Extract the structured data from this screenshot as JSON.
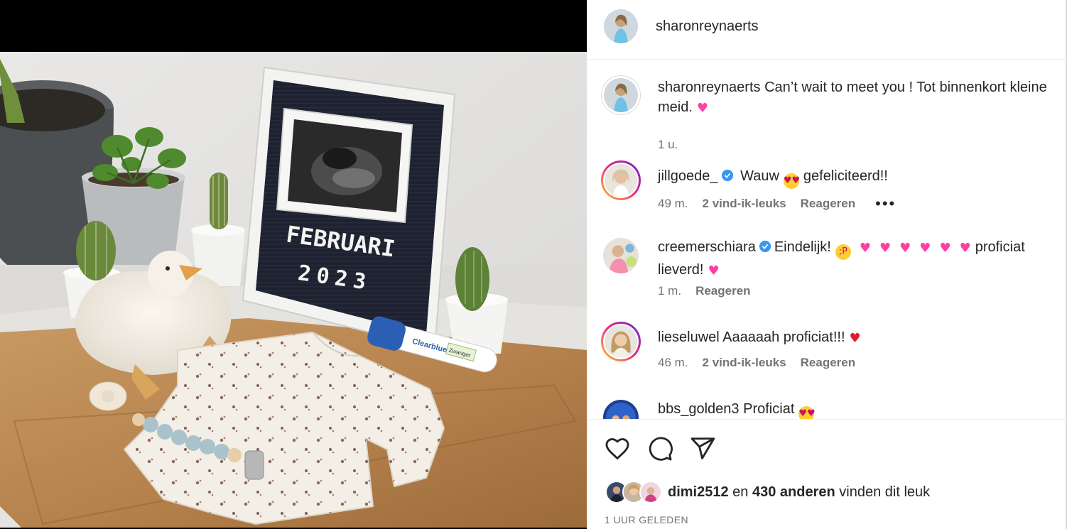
{
  "post": {
    "author": "sharonreynaerts",
    "caption": "Can’t wait to meet you ! Tot binnenkort kleine",
    "caption_line2": "meid.",
    "caption_emoji": "heart-emoji",
    "time_ago": "1 u."
  },
  "photo": {
    "letterboard_line1": "FEBRUARI",
    "letterboard_line2": "2023",
    "test_brand": "Clearblue",
    "test_result": "Zwanger"
  },
  "comments": [
    {
      "username": "jillgoede_",
      "verified": true,
      "text": "Wauw",
      "text_after": "gefeliciteerd!!",
      "time": "49 m.",
      "likes": "2 vind-ik-leuks",
      "reply": "Reageren",
      "more": "•••"
    },
    {
      "username": "creemerschiara",
      "verified": true,
      "text": "Eindelijk!",
      "text_after": "proficiat",
      "text_line2": "lieverd!",
      "time": "1 m.",
      "reply": "Reageren"
    },
    {
      "username": "lieseluwel",
      "verified": false,
      "text": "Aaaaaah proficiat!!!",
      "time": "46 m.",
      "likes": "2 vind-ik-leuks",
      "reply": "Reageren"
    },
    {
      "username": "bbs_golden3",
      "verified": false,
      "text": "Proficiat"
    }
  ],
  "likes": {
    "first_user": "dimi2512",
    "connector": "en",
    "others": "430 anderen",
    "suffix": "vinden dit leuk"
  },
  "posted": "1 UUR GELEDEN",
  "icons": {
    "like": "heart-outline-icon",
    "comment": "comment-bubble-icon",
    "share": "paper-plane-icon",
    "verified": "verified-badge-icon"
  },
  "colors": {
    "verified": "#3897f0",
    "heart_pink": "#ff3fa4",
    "heart_red": "#e21b2b",
    "muted_text": "#737373"
  }
}
